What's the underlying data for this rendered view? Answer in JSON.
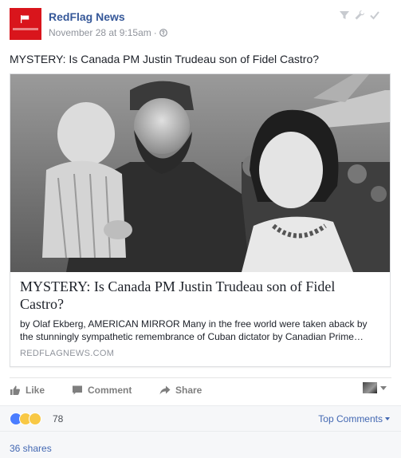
{
  "post": {
    "page_name": "RedFlag News",
    "timestamp": "November 28 at 9:15am",
    "separator": "·",
    "text": "MYSTERY: Is Canada PM Justin Trudeau son of Fidel Castro?"
  },
  "link_card": {
    "title": "MYSTERY: Is Canada PM Justin Trudeau son of Fidel Castro?",
    "description_line1": "by Olaf Ekberg, AMERICAN MIRROR Many in the free world were taken aback by",
    "description_line2": "the stunningly sympathetic remembrance of Cuban dictator by Canadian Prime…",
    "domain": "REDFLAGNEWS.COM"
  },
  "actions": {
    "like_label": "Like",
    "comment_label": "Comment",
    "share_label": "Share"
  },
  "reactions": {
    "count": "78",
    "top_comments_label": "Top Comments"
  },
  "shares": {
    "label": "36 shares"
  },
  "colors": {
    "brand_blue": "#365899",
    "link_blue": "#4267b2",
    "avatar_red": "#d9151c",
    "meta_gray": "#90949c"
  }
}
